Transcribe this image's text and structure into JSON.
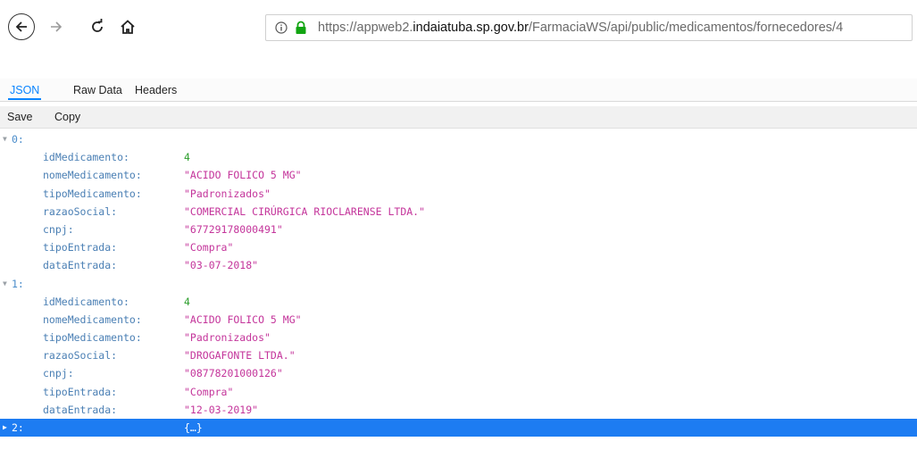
{
  "browser": {
    "url": {
      "prefix": "https://appweb2.",
      "domain": "indaiatuba.sp.gov.br",
      "path": "/FarmaciaWS/api/public/medicamentos/fornecedores/4"
    }
  },
  "viewer": {
    "tabs": [
      "JSON",
      "Raw Data",
      "Headers"
    ],
    "actions": [
      "Save",
      "Copy"
    ]
  },
  "records": [
    {
      "index": "0:",
      "fields": [
        {
          "key": "idMedicamento:",
          "value": "4",
          "type": "num"
        },
        {
          "key": "nomeMedicamento:",
          "value": "\"ACIDO FOLICO 5 MG\"",
          "type": "str"
        },
        {
          "key": "tipoMedicamento:",
          "value": "\"Padronizados\"",
          "type": "str"
        },
        {
          "key": "razaoSocial:",
          "value": "\"COMERCIAL CIRÚRGICA RIOCLARENSE LTDA.\"",
          "type": "str"
        },
        {
          "key": "cnpj:",
          "value": "\"67729178000491\"",
          "type": "str"
        },
        {
          "key": "tipoEntrada:",
          "value": "\"Compra\"",
          "type": "str"
        },
        {
          "key": "dataEntrada:",
          "value": "\"03-07-2018\"",
          "type": "str"
        }
      ]
    },
    {
      "index": "1:",
      "fields": [
        {
          "key": "idMedicamento:",
          "value": "4",
          "type": "num"
        },
        {
          "key": "nomeMedicamento:",
          "value": "\"ACIDO FOLICO 5 MG\"",
          "type": "str"
        },
        {
          "key": "tipoMedicamento:",
          "value": "\"Padronizados\"",
          "type": "str"
        },
        {
          "key": "razaoSocial:",
          "value": "\"DROGAFONTE LTDA.\"",
          "type": "str"
        },
        {
          "key": "cnpj:",
          "value": "\"08778201000126\"",
          "type": "str"
        },
        {
          "key": "tipoEntrada:",
          "value": "\"Compra\"",
          "type": "str"
        },
        {
          "key": "dataEntrada:",
          "value": "\"12-03-2019\"",
          "type": "str"
        }
      ]
    }
  ],
  "collapsed_record": {
    "index": "2:",
    "preview": "{…}"
  },
  "colors": {
    "accent": "#0a84ff",
    "selected_row": "#1d7cf2",
    "key": "#4a7fb4",
    "string": "#c4359b",
    "number": "#2a9d2a"
  }
}
